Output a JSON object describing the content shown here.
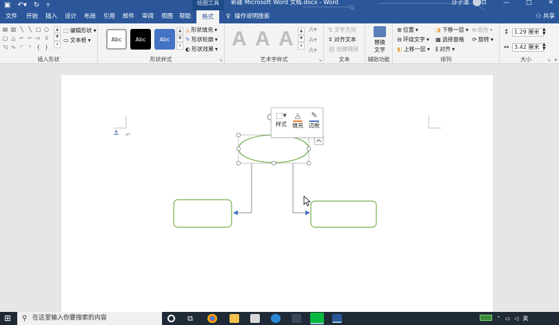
{
  "window": {
    "title": "新建 Microsoft Word 文档.docx - Word",
    "context_tools": "绘图工具",
    "user": "莎子泼"
  },
  "tabs": [
    {
      "label": "文件"
    },
    {
      "label": "开始"
    },
    {
      "label": "插入"
    },
    {
      "label": "设计"
    },
    {
      "label": "布局"
    },
    {
      "label": "引用"
    },
    {
      "label": "邮件"
    },
    {
      "label": "审阅"
    },
    {
      "label": "视图"
    },
    {
      "label": "帮助"
    },
    {
      "label": "格式",
      "active": true
    }
  ],
  "tell_me": "操作说明搜索",
  "share": "共享",
  "ribbon": {
    "insert_shapes": {
      "label": "插入形状",
      "edit_shape": "编辑形状",
      "text_box": "文本框"
    },
    "shape_styles": {
      "label": "形状样式",
      "style_text": "Abc",
      "fill": "形状填充",
      "outline": "形状轮廓",
      "effects": "形状效果"
    },
    "wordart": {
      "label": "艺术字样式",
      "sample": "A"
    },
    "text": {
      "label": "文本",
      "direction": "文字方向",
      "align": "对齐文本",
      "link": "创建链接"
    },
    "accessibility": {
      "label": "辅助功能",
      "alt_text_1": "替换",
      "alt_text_2": "文字"
    },
    "arrange": {
      "label": "排列",
      "position": "位置",
      "wrap": "环绕文字",
      "bring_forward": "上移一层",
      "send_backward": "下移一层",
      "selection_pane": "选择窗格",
      "align": "对齐",
      "group": "组合",
      "rotate": "旋转"
    },
    "size": {
      "label": "大小",
      "height": "1.29 厘米",
      "width": "3.42 厘米"
    }
  },
  "mini_toolbar": {
    "style": "样式",
    "fill": "填充",
    "border": "边框"
  },
  "taskbar": {
    "search_placeholder": "在这里输入你要搜索的内容"
  },
  "colors": {
    "accent": "#2b579a",
    "shape_outline": "#70ad47",
    "connector": "#4472c4"
  }
}
